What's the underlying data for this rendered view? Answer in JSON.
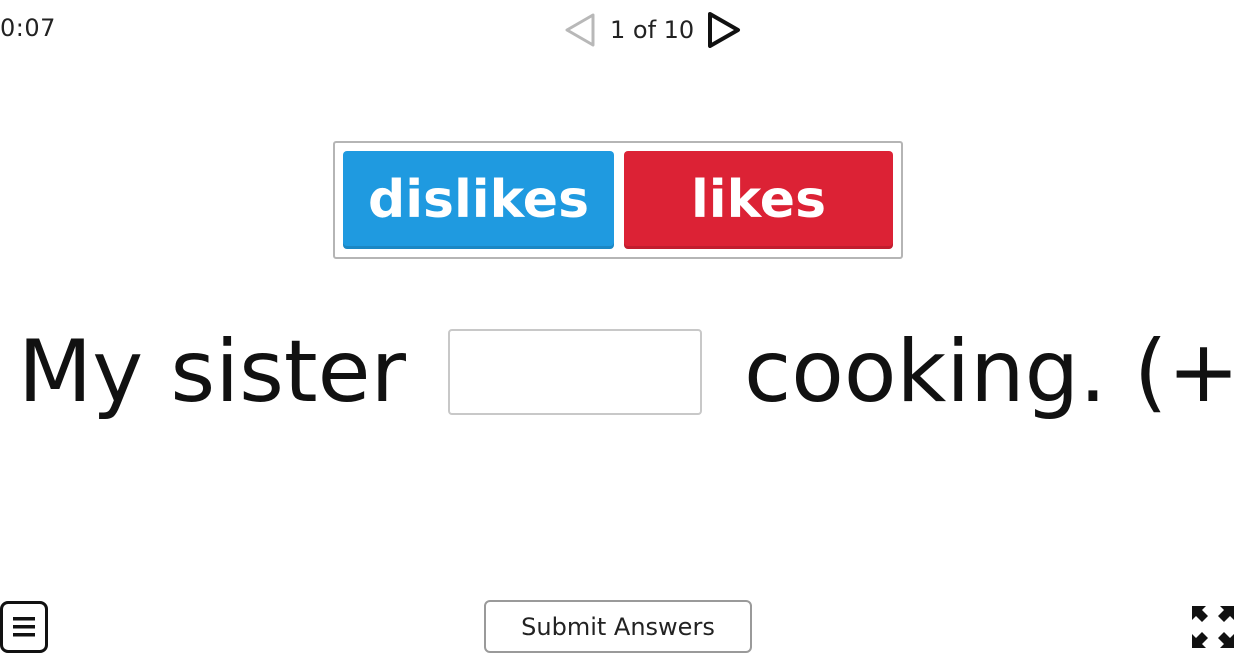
{
  "timer": {
    "value": "0:07"
  },
  "pager": {
    "counter": "1 of 10",
    "prev_icon": "chevron-left-outline-icon",
    "next_icon": "chevron-right-outline-icon"
  },
  "word_bank": {
    "tiles": [
      {
        "label": "dislikes",
        "color": "#1f9ae0"
      },
      {
        "label": "likes",
        "color": "#dc2235"
      }
    ]
  },
  "question": {
    "before_gap": "My sister",
    "after_gap": "cooking. (+)",
    "answer_value": ""
  },
  "footer": {
    "menu_icon": "hamburger-menu-icon",
    "submit_label": "Submit Answers",
    "fullscreen_icon": "fullscreen-icon"
  }
}
